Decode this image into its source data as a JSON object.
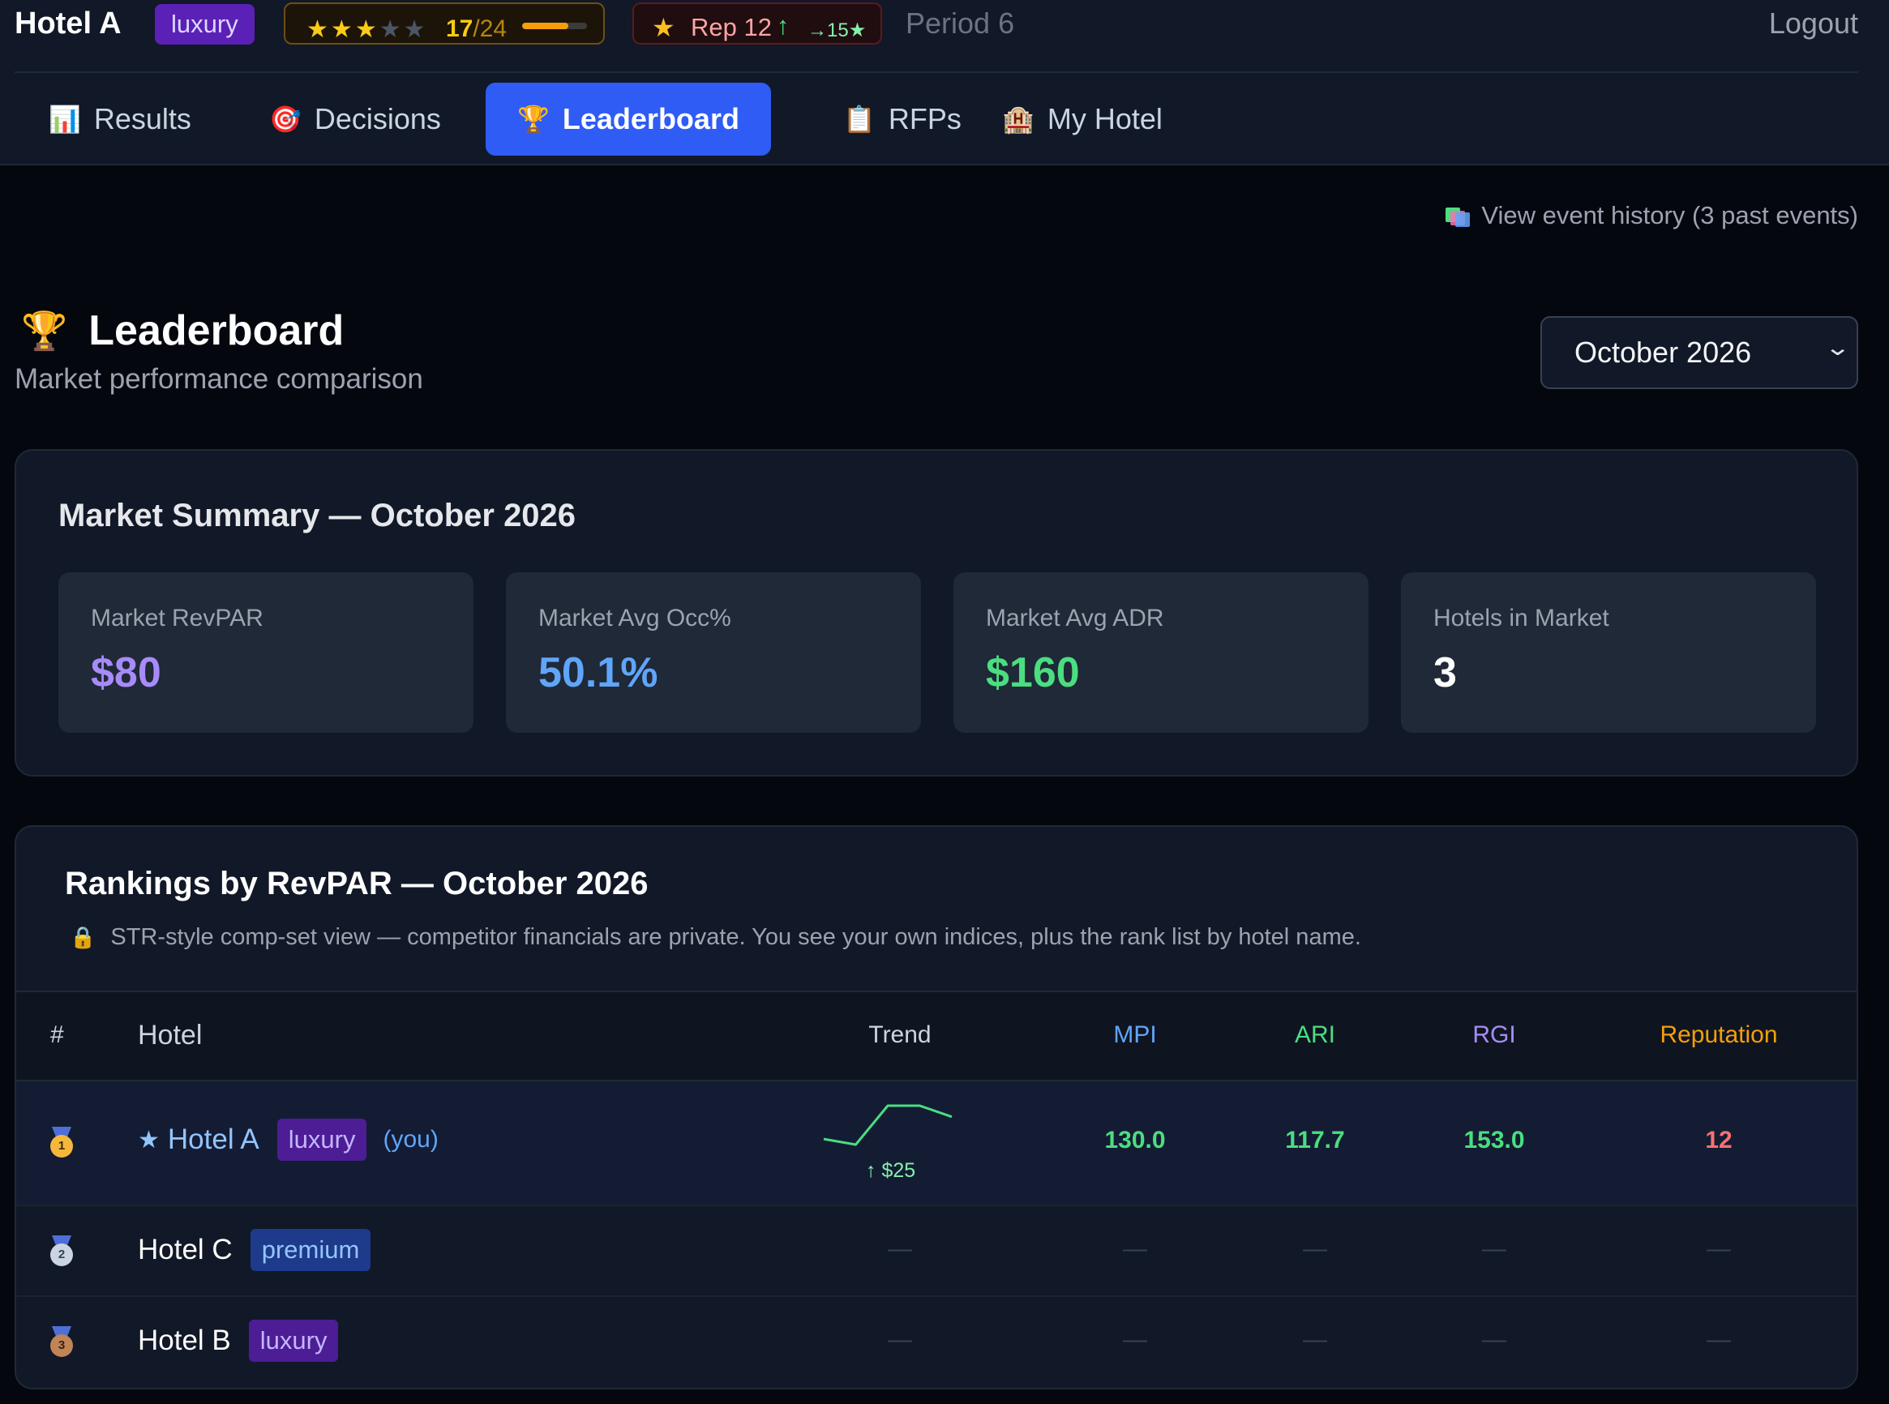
{
  "header": {
    "hotel_name": "Hotel A",
    "tier": "luxury",
    "stars": {
      "filled": 3,
      "total": 5,
      "score": "17",
      "score_max": "/24",
      "progress": 0.71
    },
    "reputation": {
      "label": "Rep 12",
      "arrow": "↑",
      "target": "→15★"
    },
    "period": "Period 6",
    "logout": "Logout"
  },
  "tabs": [
    {
      "icon": "📊",
      "label": "Results"
    },
    {
      "icon": "🎯",
      "label": "Decisions"
    },
    {
      "icon": "🏆",
      "label": "Leaderboard",
      "active": true
    },
    {
      "icon": "📋",
      "label": "RFPs"
    },
    {
      "icon": "🏨",
      "label": "My Hotel"
    }
  ],
  "event_history": {
    "label": "View event history (3 past events)"
  },
  "page": {
    "icon": "🏆",
    "title": "Leaderboard",
    "subtitle": "Market performance comparison",
    "selected_month": "October 2026"
  },
  "market_summary": {
    "title": "Market Summary — October 2026",
    "metrics": [
      {
        "label": "Market RevPAR",
        "value": "$80",
        "color": "#a78bfa"
      },
      {
        "label": "Market Avg Occ%",
        "value": "50.1%",
        "color": "#60a5fa"
      },
      {
        "label": "Market Avg ADR",
        "value": "$160",
        "color": "#4ade80"
      },
      {
        "label": "Hotels in Market",
        "value": "3",
        "color": "#ffffff"
      }
    ]
  },
  "rankings": {
    "title": "Rankings by RevPAR — October 2026",
    "note_icon": "🔒",
    "note": "STR-style comp-set view — competitor financials are private. You see your own indices, plus the rank list by hotel name.",
    "columns": {
      "rank": "#",
      "hotel": "Hotel",
      "trend": "Trend",
      "mpi": "MPI",
      "ari": "ARI",
      "rgi": "RGI",
      "reputation": "Reputation"
    },
    "column_colors": {
      "mpi": "#60a5fa",
      "ari": "#4ade80",
      "rgi": "#a78bfa",
      "reputation": "#f59e0b"
    },
    "rows": [
      {
        "rank": "1",
        "star": "★",
        "hotel": "Hotel A",
        "tier": "luxury",
        "you": "(you)",
        "trend_label": "↑ $25",
        "trend_points": [
          3,
          2,
          9,
          9,
          7
        ],
        "mpi": "130.0",
        "ari": "117.7",
        "rgi": "153.0",
        "reputation": "12"
      },
      {
        "rank": "2",
        "hotel": "Hotel C",
        "tier": "premium",
        "trend": "—",
        "mpi": "—",
        "ari": "—",
        "rgi": "—",
        "reputation": "—"
      },
      {
        "rank": "3",
        "hotel": "Hotel B",
        "tier": "luxury",
        "trend": "—",
        "mpi": "—",
        "ari": "—",
        "rgi": "—",
        "reputation": "—"
      }
    ]
  }
}
